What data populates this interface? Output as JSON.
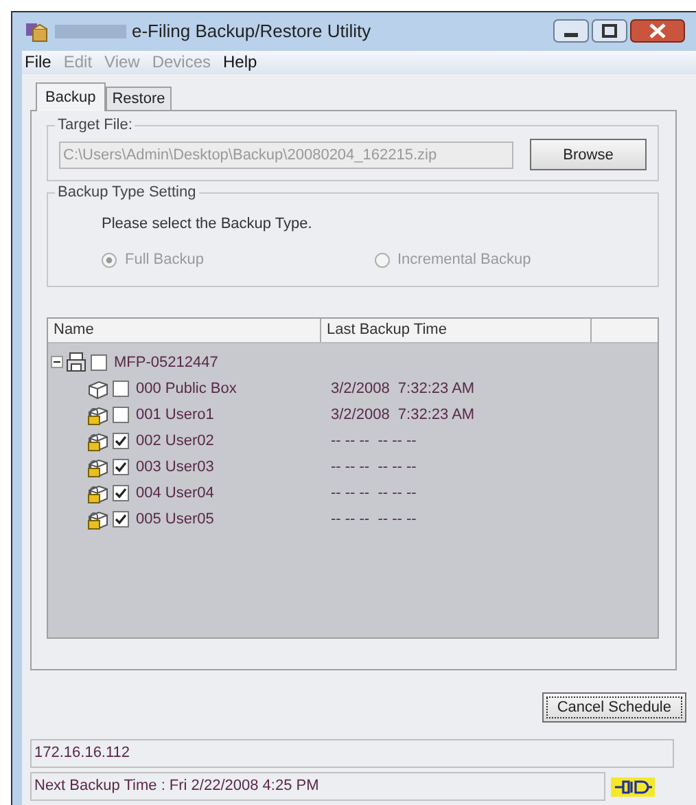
{
  "window": {
    "title": "e-Filing Backup/Restore Utility"
  },
  "menu": [
    {
      "label": "File",
      "disabled": false
    },
    {
      "label": "Edit",
      "disabled": true
    },
    {
      "label": "View",
      "disabled": true
    },
    {
      "label": "Devices",
      "disabled": true
    },
    {
      "label": "Help",
      "disabled": false
    }
  ],
  "tabs": [
    {
      "label": "Backup",
      "selected": true
    },
    {
      "label": "Restore",
      "selected": false
    }
  ],
  "target_file": {
    "legend": "Target File:",
    "value": "C:\\Users\\Admin\\Desktop\\Backup\\20080204_162215.zip",
    "browse_button": "Browse"
  },
  "backup_type": {
    "legend": "Backup Type Setting",
    "prompt": "Please select the Backup Type.",
    "disabled": true,
    "options": [
      {
        "label": "Full Backup",
        "selected": true
      },
      {
        "label": "Incremental Backup",
        "selected": false
      }
    ]
  },
  "tree": {
    "columns": [
      "Name",
      "Last Backup Time"
    ],
    "root": {
      "name": "MFP-05212447",
      "expanded": true,
      "checked": false,
      "children": [
        {
          "name": "000 Public Box",
          "time": "3/2/2008  7:32:23 AM",
          "checked": false,
          "locked": false
        },
        {
          "name": "001 Usero1",
          "time": "3/2/2008  7:32:23 AM",
          "checked": false,
          "locked": true
        },
        {
          "name": "002 User02",
          "time": "-- -- --  -- -- --",
          "checked": true,
          "locked": true
        },
        {
          "name": "003 User03",
          "time": "-- -- --  -- -- --",
          "checked": true,
          "locked": true
        },
        {
          "name": "004 User04",
          "time": "-- -- --  -- -- --",
          "checked": true,
          "locked": true
        },
        {
          "name": "005 User05",
          "time": "-- -- --  -- -- --",
          "checked": true,
          "locked": true
        }
      ]
    }
  },
  "cancel_button": "Cancel Schedule",
  "address": "172.16.16.112",
  "status_bar": {
    "text": "Next Backup Time : Fri 2/22/2008  4:25 PM",
    "connected": true
  }
}
